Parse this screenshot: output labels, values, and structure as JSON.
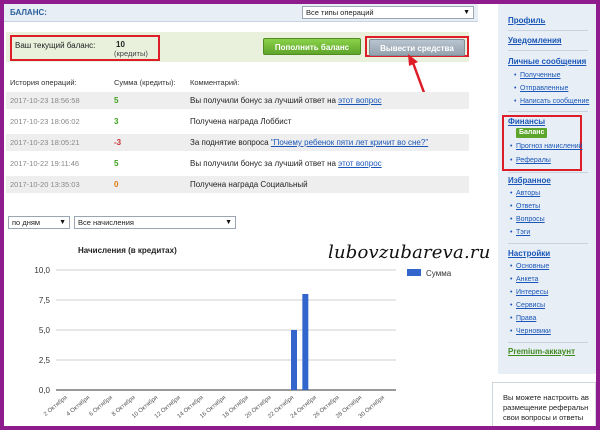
{
  "header": {
    "title": "БАЛАНС:",
    "ops_type_select": "Все типы операций"
  },
  "balance": {
    "label": "Ваш текущий баланс:",
    "value": "10",
    "unit": "(кредиты)",
    "topup_button": "Пополнить баланс",
    "withdraw_button": "Вывести средства"
  },
  "history": {
    "columns": [
      "История операций:",
      "Сумма (кредиты):",
      "Комментарий:"
    ],
    "rows": [
      {
        "date": "2017-10-23 18:56:58",
        "amount": "5",
        "comment": "Вы получили бонус за лучший ответ на ",
        "link": "этот вопрос"
      },
      {
        "date": "2017-10-23 18:06:02",
        "amount": "3",
        "comment": "Получена награда Лоббист",
        "link": ""
      },
      {
        "date": "2017-10-23 18:05:21",
        "amount": "-3",
        "comment": "За поднятие вопроса ",
        "link": "\"Почему ребенок пяти лет кричит во сне?\""
      },
      {
        "date": "2017-10-22 19:11:46",
        "amount": "5",
        "comment": "Вы получили бонус за лучший ответ на ",
        "link": "этот вопрос"
      },
      {
        "date": "2017-10-20 13:35:03",
        "amount": "0",
        "comment": "Получена награда Социальный",
        "link": ""
      }
    ]
  },
  "filters": {
    "period": "по дням",
    "accruals": "Все начисления"
  },
  "watermark": "lubovzubareva.ru",
  "chart_data": {
    "type": "bar",
    "title": "Начисления (в кредитах)",
    "categories": [
      "2 Октября",
      "4 Октября",
      "6 Октября",
      "8 Октября",
      "10 Октября",
      "12 Октября",
      "14 Октября",
      "16 Октября",
      "18 Октября",
      "20 Октября",
      "22 Октября",
      "24 Октября",
      "26 Октября",
      "28 Октября",
      "30 Октября"
    ],
    "series": [
      {
        "name": "Сумма",
        "points": [
          {
            "x": "22 Октября",
            "y": 5
          },
          {
            "x": "23 Октября",
            "y": 8
          }
        ]
      }
    ],
    "y_ticks": [
      "10,0",
      "7,5",
      "5,0",
      "2,5",
      "0,0"
    ],
    "ylim": [
      0,
      10
    ],
    "grid": true,
    "legend": "top-right",
    "color": "#3366cc"
  },
  "sidebar": {
    "profile": "Профиль",
    "notifications": "Уведомления",
    "messages": "Личные сообщения",
    "messages_items": [
      "Полученные",
      "Отправленные",
      "Написать сообщение"
    ],
    "finance": "Финансы",
    "finance_items": [
      "Баланс",
      "Прогноз начислений",
      "Рефералы"
    ],
    "favorites": "Избранное",
    "favorites_items": [
      "Авторы",
      "Ответы",
      "Вопросы",
      "Тэги"
    ],
    "settings": "Настройки",
    "settings_items": [
      "Основные",
      "Анкета",
      "Интересы",
      "Сервисы",
      "Права",
      "Черновики"
    ],
    "premium": "Premium-аккаунт"
  },
  "promo": [
    "Вы можете настроить ав",
    "размещение реферальн",
    "свои вопросы и ответы"
  ]
}
